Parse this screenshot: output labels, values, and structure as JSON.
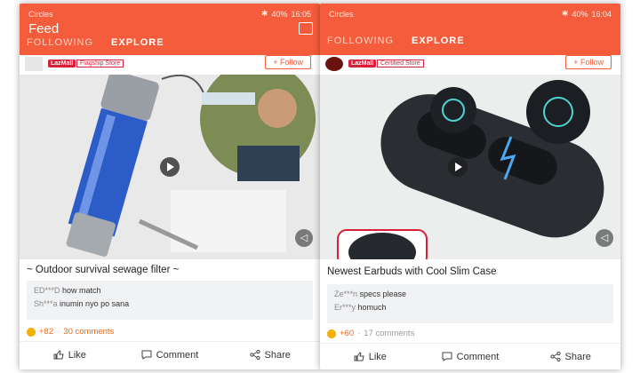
{
  "colors": {
    "brand": "#f45c3b",
    "lazmall_red": "#d8203a",
    "coin": "#f6b400"
  },
  "left_phone": {
    "status": {
      "carrier": "Circles",
      "battery": "40%",
      "time": "16:05"
    },
    "title": "Feed",
    "tabs": [
      "FOLLOWING",
      "EXPLORE"
    ],
    "active_tab": "EXPLORE",
    "store": {
      "badge": "LazMall",
      "tag": "Flagship Store",
      "follow": "+ Follow"
    },
    "caption": "~ Outdoor survival sewage filter  ~",
    "comments": [
      {
        "user": "ED***D",
        "text": "how match"
      },
      {
        "user": "Sh***a",
        "text": "inumin nyo po sana"
      }
    ],
    "points": "+82",
    "comment_count": "30 comments",
    "actions": {
      "like": "Like",
      "comment": "Comment",
      "share": "Share"
    }
  },
  "right_phone": {
    "status": {
      "carrier": "Circles",
      "battery": "40%",
      "time": "16:04"
    },
    "tabs": [
      "FOLLOWING",
      "EXPLORE"
    ],
    "active_tab": "EXPLORE",
    "store": {
      "badge": "LazMall",
      "tag": "Certified Store",
      "follow": "+ Follow"
    },
    "caption": "Newest Earbuds with Cool Slim Case",
    "comments": [
      {
        "user": "Ze***n",
        "text": "specs please"
      },
      {
        "user": "Er***y",
        "text": "homuch"
      }
    ],
    "points": "+60",
    "comment_count": "17 comments",
    "actions": {
      "like": "Like",
      "comment": "Comment",
      "share": "Share"
    }
  }
}
